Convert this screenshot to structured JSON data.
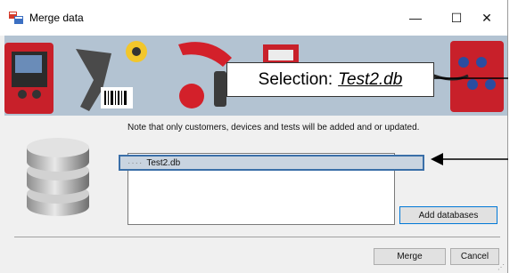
{
  "window": {
    "title": "Merge data"
  },
  "titlebar": {
    "minimize": "—",
    "maximize": "☐",
    "close": "✕"
  },
  "banner": {
    "callout_prefix": "Selection:",
    "callout_file": "Test2.db"
  },
  "main": {
    "note": "Note that only customers, devices and tests will be added and or updated.",
    "databases": [
      {
        "label": "Test2.db"
      }
    ]
  },
  "buttons": {
    "add_databases": "Add databases",
    "merge": "Merge",
    "cancel": "Cancel"
  },
  "colors": {
    "selection_border": "#3a6fa8",
    "selection_fill": "#c9d4e0",
    "focus_border": "#0078d7"
  },
  "icons": {
    "app": "merge-app-icon",
    "database": "database-icon",
    "annotation": "arrow-icon"
  }
}
